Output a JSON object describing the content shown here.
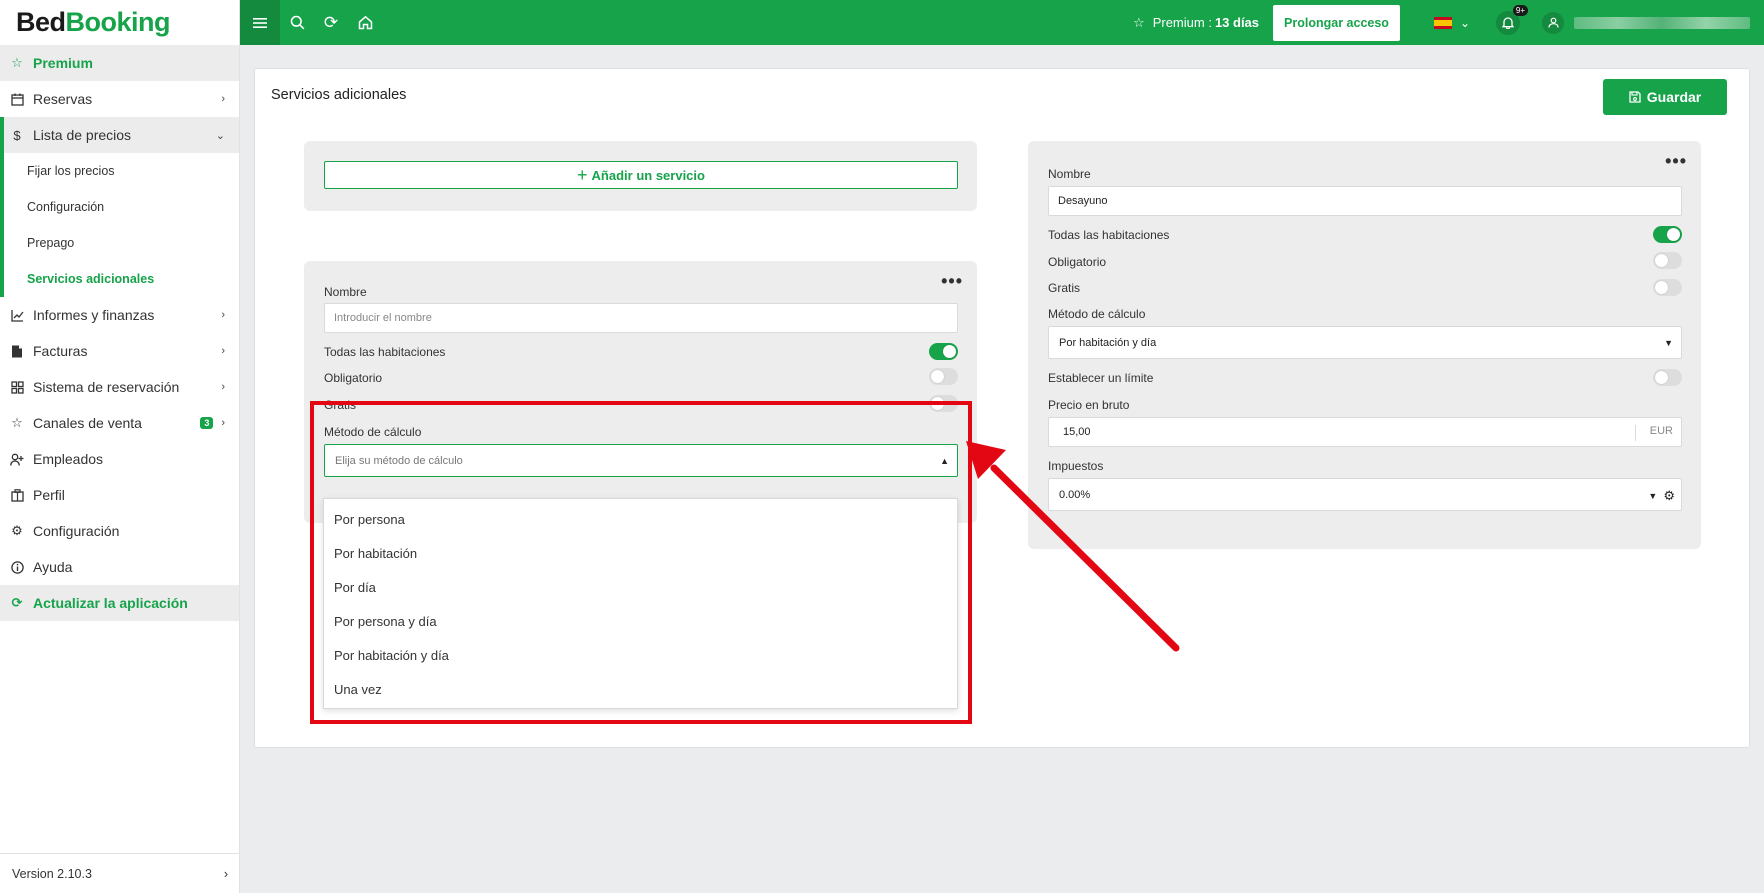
{
  "brand": {
    "part1": "Bed",
    "part2": "Booking"
  },
  "sidebar": {
    "premium": "Premium",
    "items": [
      {
        "label": "Reservas"
      },
      {
        "label": "Lista de precios"
      }
    ],
    "sub_items": [
      {
        "label": "Fijar los precios"
      },
      {
        "label": "Configuración"
      },
      {
        "label": "Prepago"
      },
      {
        "label": "Servicios adicionales"
      }
    ],
    "items2": [
      {
        "label": "Informes y finanzas"
      },
      {
        "label": "Facturas"
      },
      {
        "label": "Sistema de reservación"
      },
      {
        "label": "Canales de venta",
        "badge": "3"
      },
      {
        "label": "Empleados"
      },
      {
        "label": "Perfil"
      },
      {
        "label": "Configuración"
      },
      {
        "label": "Ayuda"
      }
    ],
    "update": "Actualizar la aplicación",
    "version": "Version 2.10.3"
  },
  "topbar": {
    "premium_label": "Premium :",
    "premium_days": "13 días",
    "prolong_button": "Prolongar acceso",
    "notif_count": "9+"
  },
  "page": {
    "title": "Servicios adicionales",
    "save_button": "Guardar",
    "add_service_button": "Añadir un servicio"
  },
  "new_service": {
    "name_label": "Nombre",
    "name_placeholder": "Introducir el nombre",
    "all_rooms_label": "Todas las habitaciones",
    "mandatory_label": "Obligatorio",
    "free_label": "Gratis",
    "method_label": "Método de cálculo",
    "method_placeholder": "Elija su método de cálculo",
    "method_options": [
      "Por persona",
      "Por habitación",
      "Por día",
      "Por persona y día",
      "Por habitación y día",
      "Una vez"
    ]
  },
  "existing_service": {
    "name_label": "Nombre",
    "name_value": "Desayuno",
    "all_rooms_label": "Todas las habitaciones",
    "mandatory_label": "Obligatorio",
    "free_label": "Gratis",
    "method_label": "Método de cálculo",
    "method_value": "Por habitación y día",
    "limit_label": "Establecer un límite",
    "price_label": "Precio en bruto",
    "price_value": "15,00",
    "currency": "EUR",
    "tax_label": "Impuestos",
    "tax_value": "0.00%"
  },
  "colors": {
    "brand_green": "#16a34a",
    "annotation_red": "#e30613"
  }
}
